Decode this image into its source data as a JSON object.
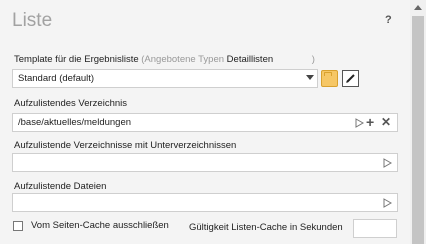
{
  "header": {
    "title": "Liste",
    "help": "?"
  },
  "template": {
    "label": "Template für die Ergebnisliste",
    "label_muted": "(Angebotene Typen",
    "label_types": "Detaillisten",
    "label_close": ")",
    "value": "Standard (default)"
  },
  "directory": {
    "label": "Aufzulistendes Verzeichnis",
    "value": "/base/aktuelles/meldungen",
    "add": "+",
    "remove": "✕"
  },
  "subdirs": {
    "label": "Aufzulistende Verzeichnisse mit Unterverzeichnissen",
    "value": ""
  },
  "files": {
    "label": "Aufzulistende Dateien",
    "value": ""
  },
  "cache": {
    "checkbox_label": "Vom Seiten-Cache ausschließen",
    "validity_label": "Gültigkeit Listen-Cache in Sekunden",
    "validity_value": ""
  },
  "icons": {
    "select": "chevron-down-icon",
    "folder": "folder-icon",
    "edit": "edit-icon",
    "pick": "triangle-select-icon",
    "scroll": "arrow-up-icon"
  },
  "colors": {
    "folder": "#f6c766",
    "title": "#a2a2a2"
  }
}
